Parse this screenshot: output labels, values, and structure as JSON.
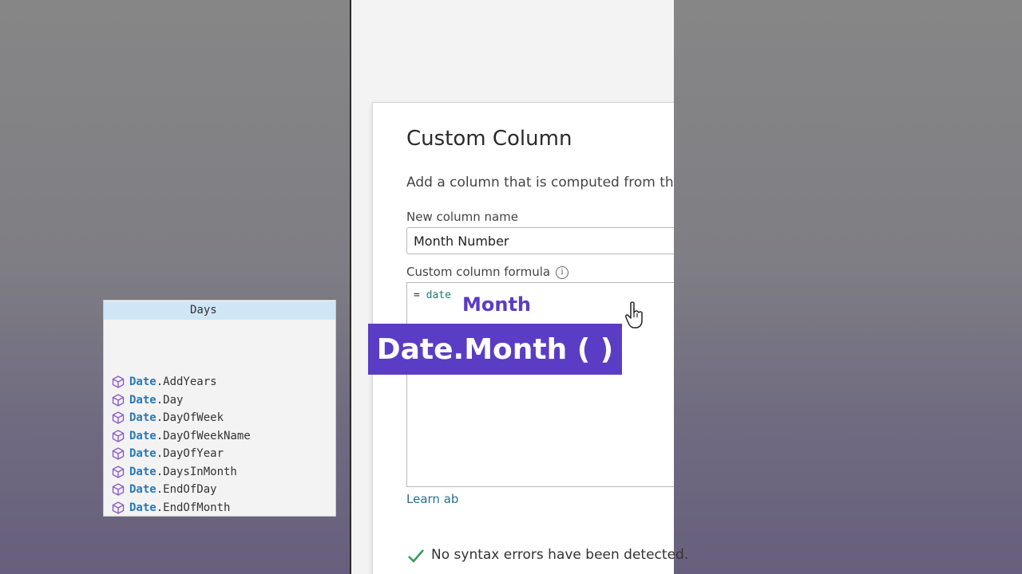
{
  "dialog": {
    "title": "Custom Column",
    "description": "Add a column that is computed from the",
    "name_label": "New column name",
    "name_value": "Month Number",
    "formula_label": "Custom column formula",
    "formula_prefix": "= ",
    "formula_value": "date",
    "learn_link": "Learn ab",
    "status_text": "No syntax errors have been detected."
  },
  "suggestions": {
    "selected_suffix": "Days",
    "items": [
      {
        "ns": "Date",
        "name": ".AddYears"
      },
      {
        "ns": "Date",
        "name": ".Day"
      },
      {
        "ns": "Date",
        "name": ".DayOfWeek"
      },
      {
        "ns": "Date",
        "name": ".DayOfWeekName"
      },
      {
        "ns": "Date",
        "name": ".DayOfYear"
      },
      {
        "ns": "Date",
        "name": ".DaysInMonth"
      },
      {
        "ns": "Date",
        "name": ".EndOfDay"
      },
      {
        "ns": "Date",
        "name": ".EndOfMonth"
      }
    ]
  },
  "overlay": {
    "small_caption": "Month",
    "big_caption": "Date.Month ( )"
  },
  "colors": {
    "accent_purple": "#5a3dc4",
    "namespace_blue": "#2b78b8",
    "selection": "#cfe6f7",
    "success_green": "#3a9a5a"
  },
  "icons": {
    "suggestion_item": "cube-icon",
    "info": "info-icon",
    "status": "check-icon",
    "pointer": "hand-cursor-icon"
  }
}
